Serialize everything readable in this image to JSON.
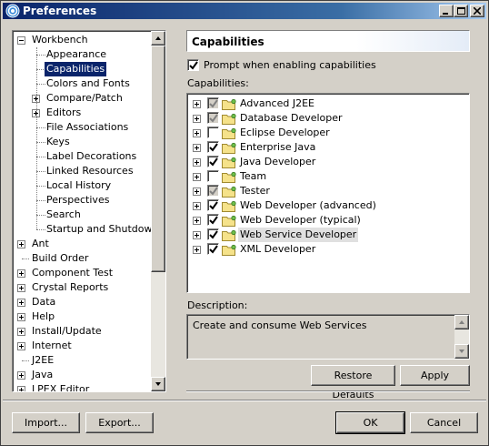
{
  "window": {
    "title": "Preferences"
  },
  "tree": {
    "items": [
      {
        "label": "Workbench",
        "level": 0,
        "expander": "minus"
      },
      {
        "label": "Appearance",
        "level": 1,
        "expander": "none"
      },
      {
        "label": "Capabilities",
        "level": 1,
        "expander": "none",
        "selected": true
      },
      {
        "label": "Colors and Fonts",
        "level": 1,
        "expander": "none"
      },
      {
        "label": "Compare/Patch",
        "level": 1,
        "expander": "plus"
      },
      {
        "label": "Editors",
        "level": 1,
        "expander": "plus"
      },
      {
        "label": "File Associations",
        "level": 1,
        "expander": "none"
      },
      {
        "label": "Keys",
        "level": 1,
        "expander": "none"
      },
      {
        "label": "Label Decorations",
        "level": 1,
        "expander": "none"
      },
      {
        "label": "Linked Resources",
        "level": 1,
        "expander": "none"
      },
      {
        "label": "Local History",
        "level": 1,
        "expander": "none"
      },
      {
        "label": "Perspectives",
        "level": 1,
        "expander": "none"
      },
      {
        "label": "Search",
        "level": 1,
        "expander": "none"
      },
      {
        "label": "Startup and Shutdown",
        "level": 1,
        "expander": "none"
      },
      {
        "label": "Ant",
        "level": 0,
        "expander": "plus"
      },
      {
        "label": "Build Order",
        "level": 0,
        "expander": "none"
      },
      {
        "label": "Component Test",
        "level": 0,
        "expander": "plus"
      },
      {
        "label": "Crystal Reports",
        "level": 0,
        "expander": "plus"
      },
      {
        "label": "Data",
        "level": 0,
        "expander": "plus"
      },
      {
        "label": "Help",
        "level": 0,
        "expander": "plus"
      },
      {
        "label": "Install/Update",
        "level": 0,
        "expander": "plus"
      },
      {
        "label": "Internet",
        "level": 0,
        "expander": "plus"
      },
      {
        "label": "J2EE",
        "level": 0,
        "expander": "none"
      },
      {
        "label": "Java",
        "level": 0,
        "expander": "plus"
      },
      {
        "label": "LPEX Editor",
        "level": 0,
        "expander": "plus"
      }
    ]
  },
  "page": {
    "title": "Capabilities",
    "prompt_label": "Prompt when enabling capabilities",
    "prompt_checked": true,
    "capabilities_label": "Capabilities:",
    "capabilities": [
      {
        "label": "Advanced J2EE",
        "state": "grayed"
      },
      {
        "label": "Database Developer",
        "state": "grayed"
      },
      {
        "label": "Eclipse Developer",
        "state": "unchecked"
      },
      {
        "label": "Enterprise Java",
        "state": "checked"
      },
      {
        "label": "Java Developer",
        "state": "checked"
      },
      {
        "label": "Team",
        "state": "unchecked"
      },
      {
        "label": "Tester",
        "state": "grayed"
      },
      {
        "label": "Web Developer (advanced)",
        "state": "checked"
      },
      {
        "label": "Web Developer (typical)",
        "state": "checked"
      },
      {
        "label": "Web Service Developer",
        "state": "checked",
        "highlighted": true
      },
      {
        "label": "XML Developer",
        "state": "checked"
      }
    ],
    "description_label": "Description:",
    "description_text": "Create and consume Web Services",
    "restore_defaults_label": "Restore Defaults",
    "apply_label": "Apply"
  },
  "footer": {
    "import_label": "Import...",
    "export_label": "Export...",
    "ok_label": "OK",
    "cancel_label": "Cancel"
  },
  "colors": {
    "title_bar": "#0a246a",
    "selection": "#0a246a",
    "face": "#d4d0c8"
  }
}
